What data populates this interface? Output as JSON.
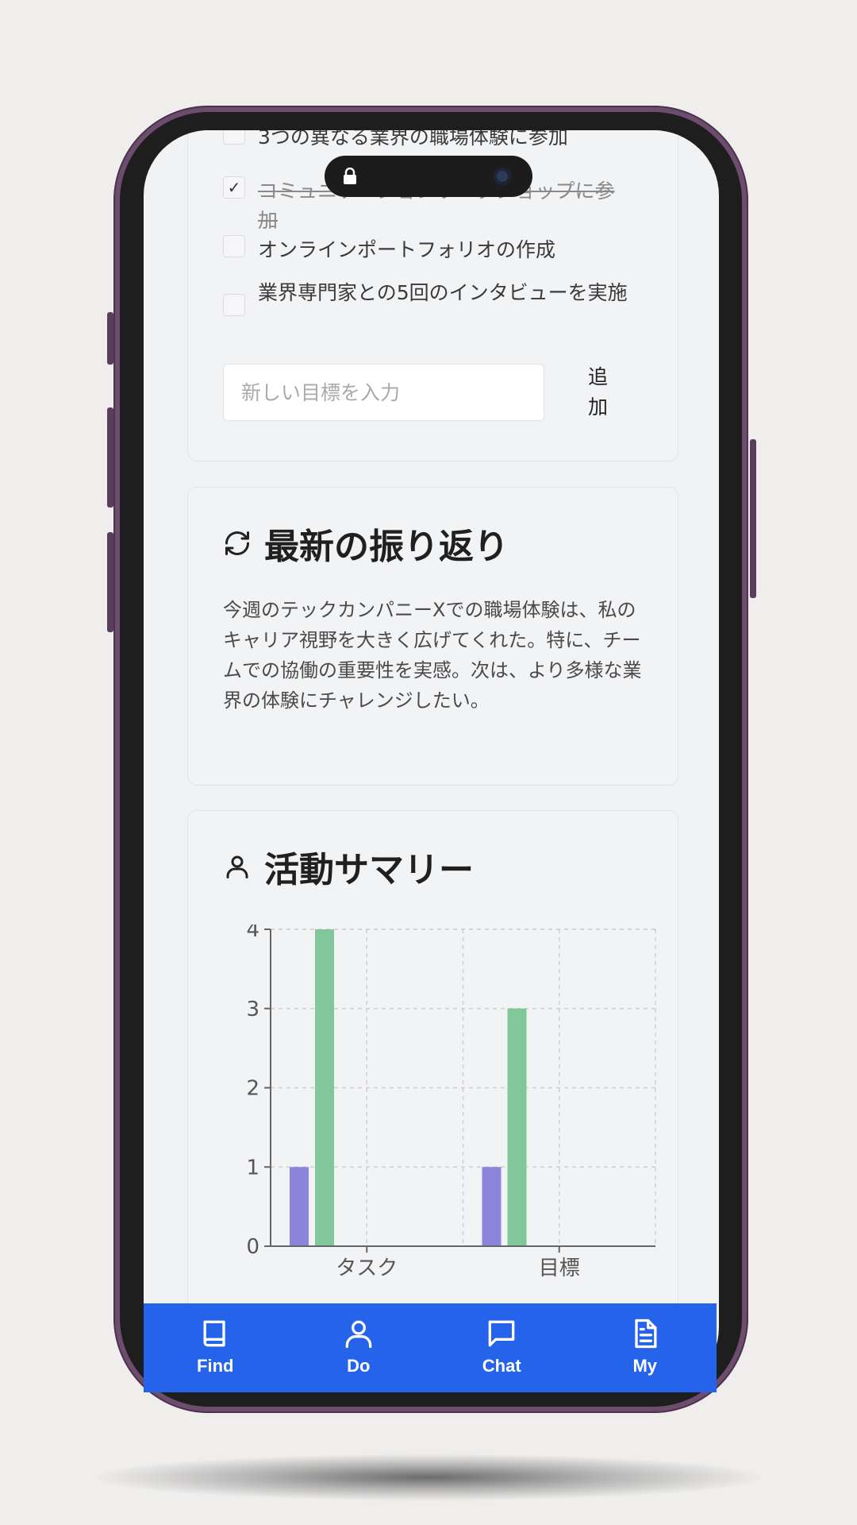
{
  "goals": {
    "items": [
      {
        "label": "3つの異なる業界の職場体験に参加",
        "checked": false
      },
      {
        "label": "コミュニケーションワークショップに参加",
        "checked": true
      },
      {
        "label": "オンラインポートフォリオの作成",
        "checked": false
      },
      {
        "label": "業界専門家との5回のインタビューを実施",
        "checked": false
      }
    ],
    "input_placeholder": "新しい目標を入力",
    "add_label": "追加"
  },
  "reflection": {
    "title": "最新の振り返り",
    "text": "今週のテックカンパニーXでの職場体験は、私のキャリア視野を大きく広げてくれた。特に、チームでの協働の重要性を実感。次は、より多様な業界の体験にチャレンジしたい。",
    "icon": "refresh-icon"
  },
  "activity": {
    "title": "活動サマリー",
    "icon": "user-icon"
  },
  "chart_data": {
    "type": "bar",
    "categories": [
      "タスク",
      "目標"
    ],
    "series": [
      {
        "values": [
          1,
          1
        ],
        "color": "#8b85dc"
      },
      {
        "values": [
          4,
          3
        ],
        "color": "#82c79a"
      }
    ],
    "ylim": [
      0,
      4
    ],
    "yticks": [
      0,
      1,
      2,
      3,
      4
    ],
    "grid": true
  },
  "tabbar": {
    "color": "#2563eb",
    "items": [
      {
        "label": "Find",
        "icon": "book-icon"
      },
      {
        "label": "Do",
        "icon": "user-icon"
      },
      {
        "label": "Chat",
        "icon": "chat-icon"
      },
      {
        "label": "My",
        "icon": "document-icon"
      }
    ]
  }
}
